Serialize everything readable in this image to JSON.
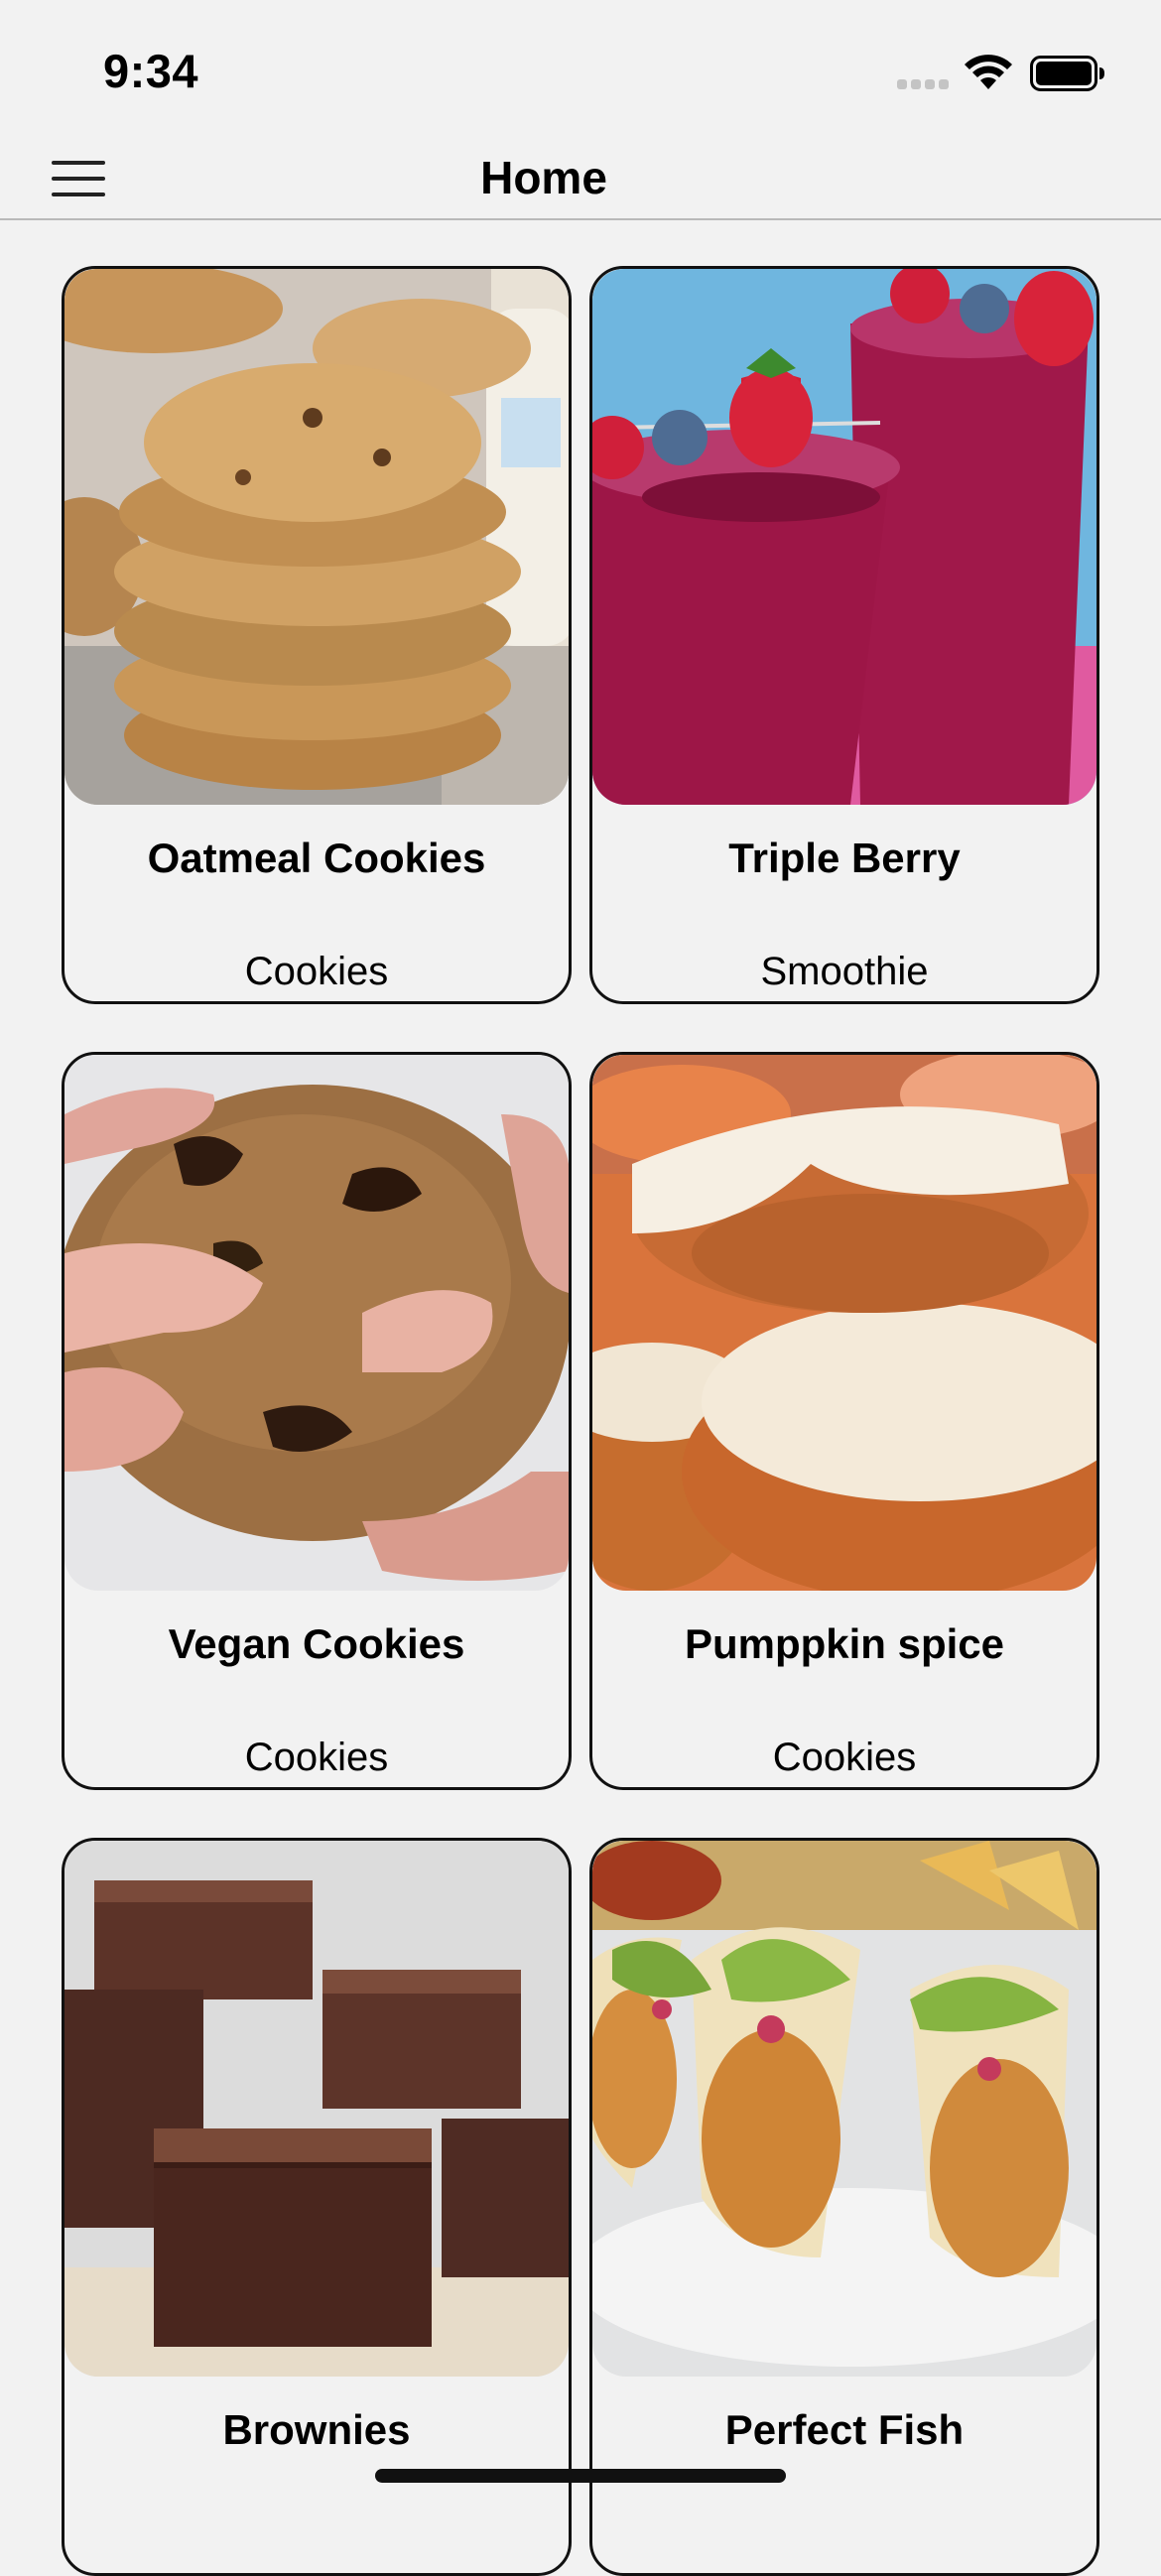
{
  "status_bar": {
    "time": "9:34",
    "signal_icon": "signal-dots-icon",
    "wifi_icon": "wifi-icon",
    "battery_icon": "battery-icon",
    "battery_level": 0.95
  },
  "nav": {
    "title": "Home",
    "menu_icon": "hamburger-menu-icon"
  },
  "recipes": [
    {
      "title": "Oatmeal Cookies",
      "category": "Cookies",
      "image": "oatmeal-cookies-photo"
    },
    {
      "title": "Triple Berry",
      "category": "Smoothie",
      "image": "berry-smoothie-photo"
    },
    {
      "title": "Vegan Cookies",
      "category": "Cookies",
      "image": "vegan-cookie-photo"
    },
    {
      "title": "Pumppkin spice",
      "category": "Cookies",
      "image": "pumpkin-cookies-photo"
    },
    {
      "title": "Brownies",
      "category": "",
      "image": "brownies-photo"
    },
    {
      "title": "Perfect Fish",
      "category": "",
      "image": "fish-tacos-photo"
    }
  ],
  "colors": {
    "background": "#f2f2f2",
    "card_border": "#111111",
    "text": "#000000"
  }
}
